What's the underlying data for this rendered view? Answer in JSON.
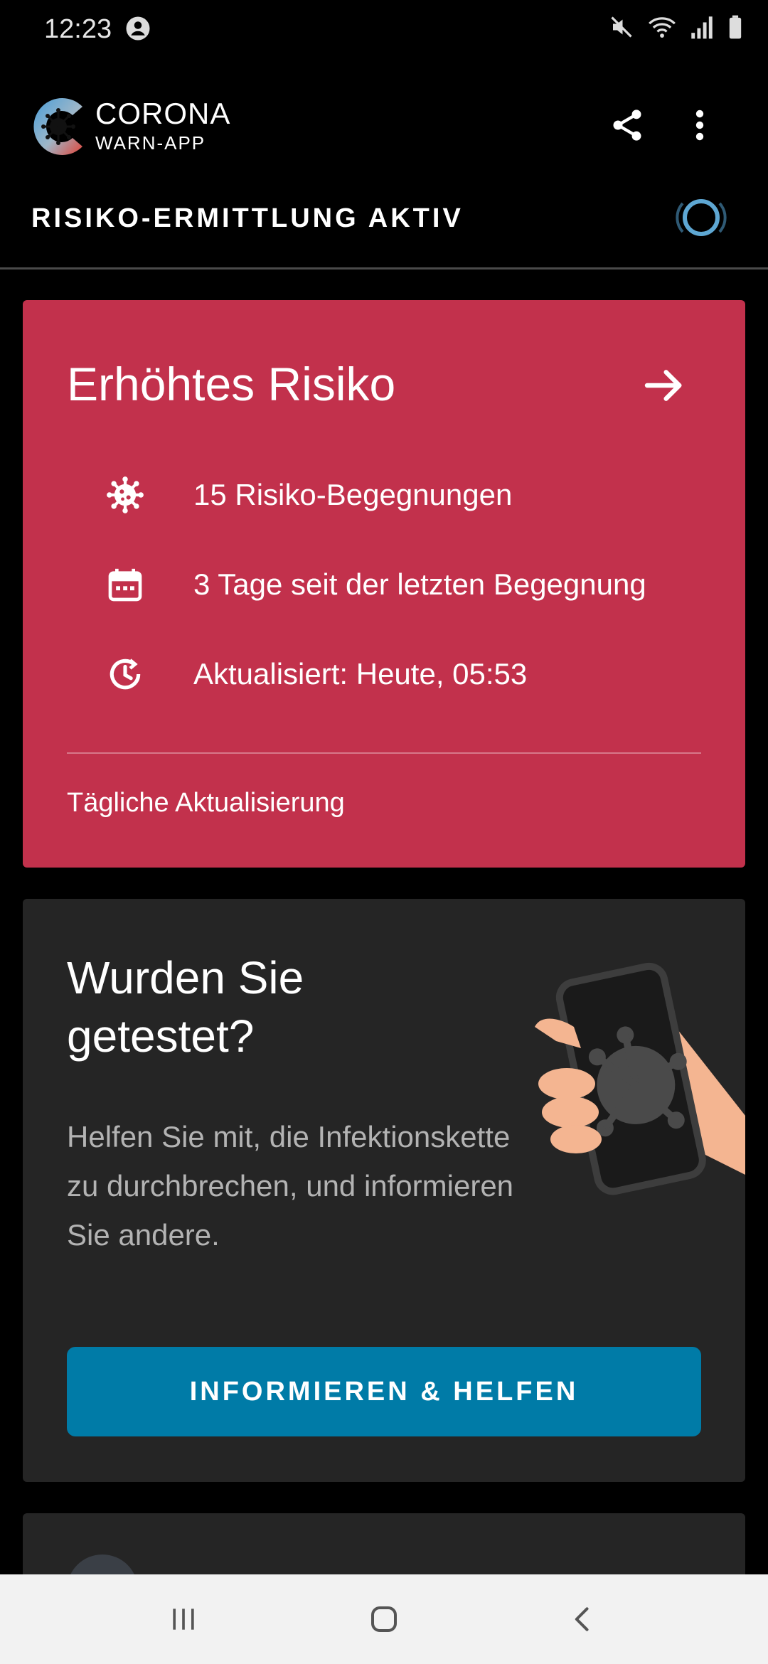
{
  "status_bar": {
    "time": "12:23"
  },
  "header": {
    "logo_line1": "CORONA",
    "logo_line2": "WARN-APP",
    "risk_status": "RISIKO-ERMITTLUNG AKTIV"
  },
  "risk_card": {
    "title": "Erhöhtes Risiko",
    "rows": [
      {
        "icon": "virus-icon",
        "text": "15 Risiko-Begegnungen"
      },
      {
        "icon": "calendar-icon",
        "text": "3 Tage seit der letzten Begegnung"
      },
      {
        "icon": "update-clock-icon",
        "text": "Aktualisiert: Heute, 05:53"
      }
    ],
    "footer": "Tägliche Aktualisierung",
    "color": "#c2314c"
  },
  "test_card": {
    "title": "Wurden Sie getestet?",
    "body": "Helfen Sie mit, die Infektionskette zu durchbrechen, und informieren Sie andere.",
    "button_label": "INFORMIEREN & HELFEN",
    "button_color": "#007ba7"
  }
}
